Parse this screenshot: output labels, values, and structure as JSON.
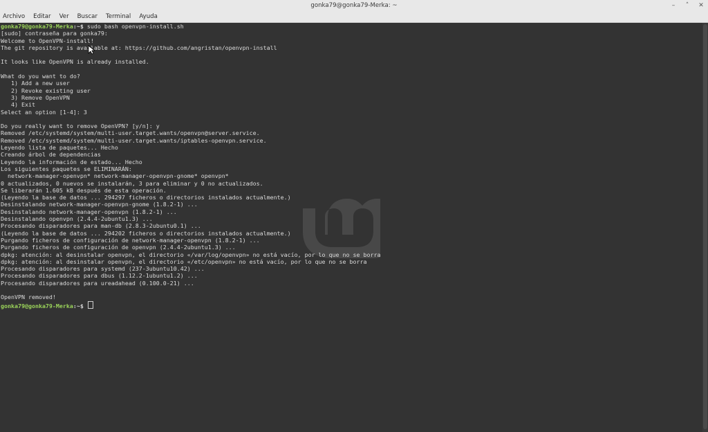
{
  "window": {
    "title": "gonka79@gonka79-Merka: ~",
    "menu": [
      "Archivo",
      "Editar",
      "Ver",
      "Buscar",
      "Terminal",
      "Ayuda"
    ]
  },
  "prompt": {
    "user_host": "gonka79@gonka79-Merka",
    "path": ":~$"
  },
  "terminal_lines": [
    {
      "kind": "prompt",
      "cmd": " sudo bash openvpn-install.sh"
    },
    {
      "kind": "text",
      "text": "[sudo] contraseña para gonka79:"
    },
    {
      "kind": "text",
      "text": "Welcome to OpenVPN-install!"
    },
    {
      "kind": "text",
      "text": "The git repository is available at: https://github.com/angristan/openvpn-install"
    },
    {
      "kind": "text",
      "text": ""
    },
    {
      "kind": "text",
      "text": "It looks like OpenVPN is already installed."
    },
    {
      "kind": "text",
      "text": ""
    },
    {
      "kind": "text",
      "text": "What do you want to do?"
    },
    {
      "kind": "text",
      "text": "   1) Add a new user"
    },
    {
      "kind": "text",
      "text": "   2) Revoke existing user"
    },
    {
      "kind": "text",
      "text": "   3) Remove OpenVPN"
    },
    {
      "kind": "text",
      "text": "   4) Exit"
    },
    {
      "kind": "text",
      "text": "Select an option [1-4]: 3"
    },
    {
      "kind": "text",
      "text": ""
    },
    {
      "kind": "text",
      "text": "Do you really want to remove OpenVPN? [y/n]: y"
    },
    {
      "kind": "text",
      "text": "Removed /etc/systemd/system/multi-user.target.wants/openvpn@server.service."
    },
    {
      "kind": "text",
      "text": "Removed /etc/systemd/system/multi-user.target.wants/iptables-openvpn.service."
    },
    {
      "kind": "text",
      "text": "Leyendo lista de paquetes... Hecho"
    },
    {
      "kind": "text",
      "text": "Creando árbol de dependencias"
    },
    {
      "kind": "text",
      "text": "Leyendo la información de estado... Hecho"
    },
    {
      "kind": "text",
      "text": "Los siguientes paquetes se ELIMINARÁN:"
    },
    {
      "kind": "text",
      "text": "  network-manager-openvpn* network-manager-openvpn-gnome* openvpn*"
    },
    {
      "kind": "text",
      "text": "0 actualizados, 0 nuevos se instalarán, 3 para eliminar y 0 no actualizados."
    },
    {
      "kind": "text",
      "text": "Se liberarán 1.605 kB después de esta operación."
    },
    {
      "kind": "text",
      "text": "(Leyendo la base de datos ... 294297 ficheros o directorios instalados actualmente.)"
    },
    {
      "kind": "text",
      "text": "Desinstalando network-manager-openvpn-gnome (1.8.2-1) ..."
    },
    {
      "kind": "text",
      "text": "Desinstalando network-manager-openvpn (1.8.2-1) ..."
    },
    {
      "kind": "text",
      "text": "Desinstalando openvpn (2.4.4-2ubuntu1.3) ..."
    },
    {
      "kind": "text",
      "text": "Procesando disparadores para man-db (2.8.3-2ubuntu0.1) ..."
    },
    {
      "kind": "text",
      "text": "(Leyendo la base de datos ... 294202 ficheros o directorios instalados actualmente.)"
    },
    {
      "kind": "text",
      "text": "Purgando ficheros de configuración de network-manager-openvpn (1.8.2-1) ..."
    },
    {
      "kind": "text",
      "text": "Purgando ficheros de configuración de openvpn (2.4.4-2ubuntu1.3) ..."
    },
    {
      "kind": "text",
      "text": "dpkg: atención: al desinstalar openvpn, el directorio «/var/log/openvpn» no está vacío, por lo que no se borra"
    },
    {
      "kind": "text",
      "text": "dpkg: atención: al desinstalar openvpn, el directorio «/etc/openvpn» no está vacío, por lo que no se borra"
    },
    {
      "kind": "text",
      "text": "Procesando disparadores para systemd (237-3ubuntu10.42) ..."
    },
    {
      "kind": "text",
      "text": "Procesando disparadores para dbus (1.12.2-1ubuntu1.2) ..."
    },
    {
      "kind": "text",
      "text": "Procesando disparadores para ureadahead (0.100.0-21) ..."
    },
    {
      "kind": "text",
      "text": ""
    },
    {
      "kind": "text",
      "text": "OpenVPN removed!"
    },
    {
      "kind": "prompt",
      "cmd": " ",
      "cursor": true
    }
  ],
  "colors": {
    "prompt_user": "#9bd45a",
    "terminal_bg": "#333333",
    "text": "#dcdcdc"
  },
  "icons": [
    "minimize-icon",
    "maximize-icon",
    "close-icon",
    "linux-mint-logo-watermark",
    "mouse-pointer-icon"
  ]
}
